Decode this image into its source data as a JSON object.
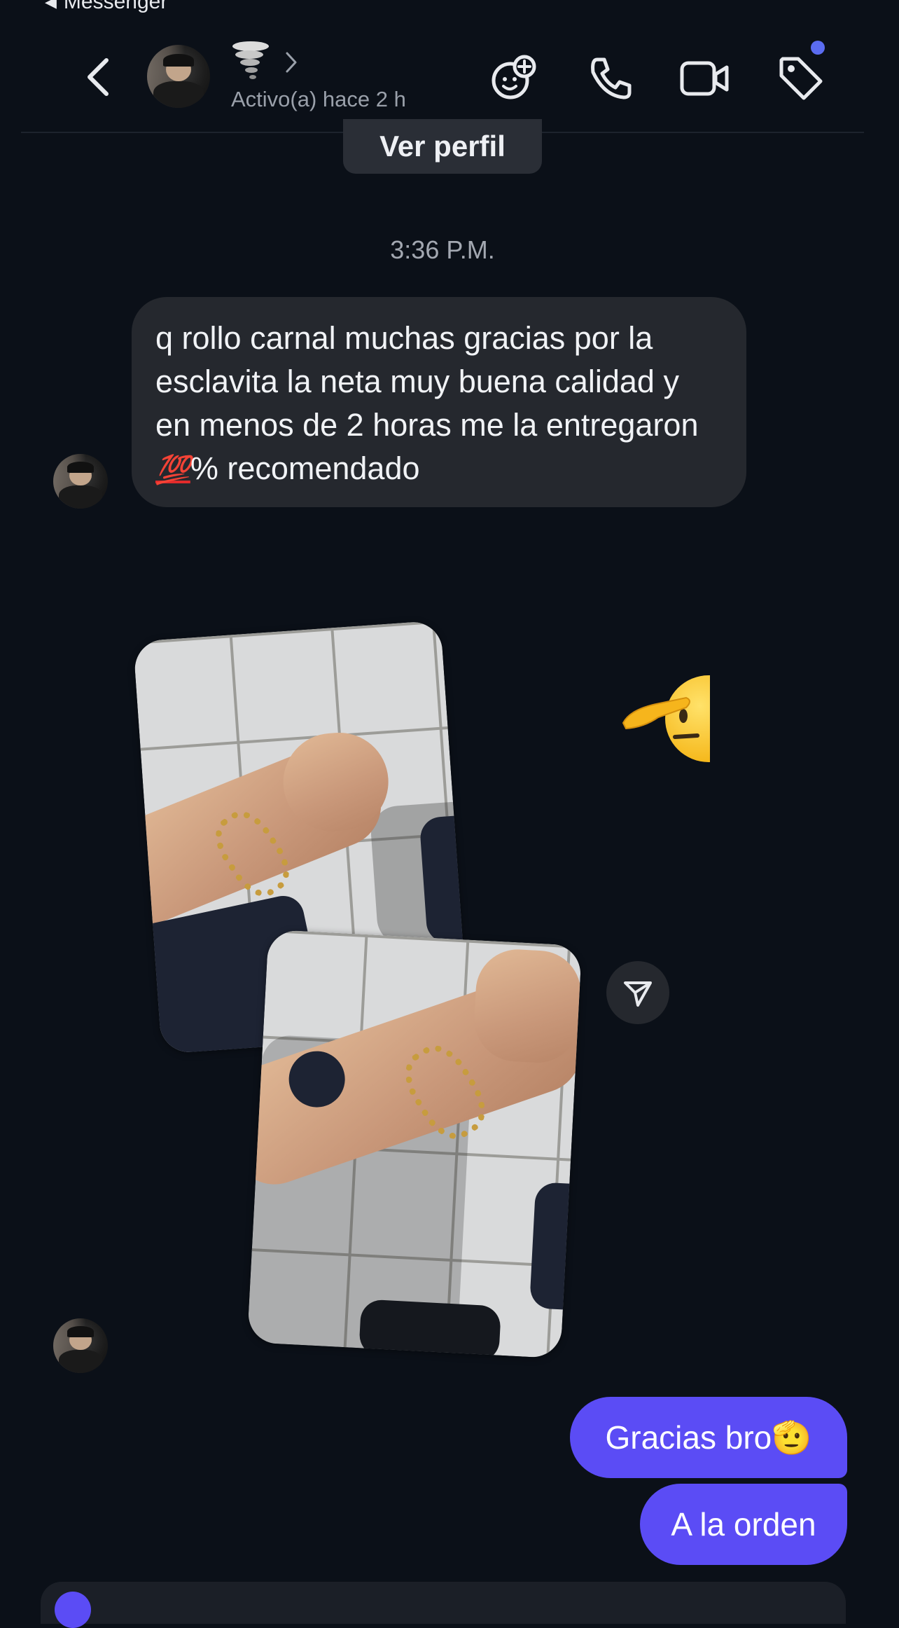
{
  "status_bar": {
    "back_app_label": "Messenger"
  },
  "header": {
    "status": "Activo(a) hace 2 h",
    "icons": {
      "back": "chevron-left-icon",
      "avatar_effects": "face-plus-icon",
      "call": "phone-icon",
      "video": "video-camera-icon",
      "tag": "tag-icon"
    },
    "notification_dot_color": "#5b6cf0"
  },
  "profile": {
    "view_profile_label": "Ver perfil"
  },
  "conversation": {
    "timestamp": "3:36 P.M.",
    "incoming_message": {
      "text_before_emoji": "q rollo carnal muchas gracias por la esclavita la neta muy buena calidad y en menos de 2 horas me la entregaron ",
      "emoji": "💯",
      "text_after_emoji": "% recomendado"
    },
    "reaction_emoji_name": "saluting-face-emoji",
    "outgoing_messages": [
      {
        "text": "Gracias bro",
        "emoji": "🫡"
      },
      {
        "text": "A la orden"
      }
    ]
  },
  "colors": {
    "background": "#0b1018",
    "incoming_bubble": "#25282e",
    "outgoing_bubble": "#5b4cf5"
  }
}
